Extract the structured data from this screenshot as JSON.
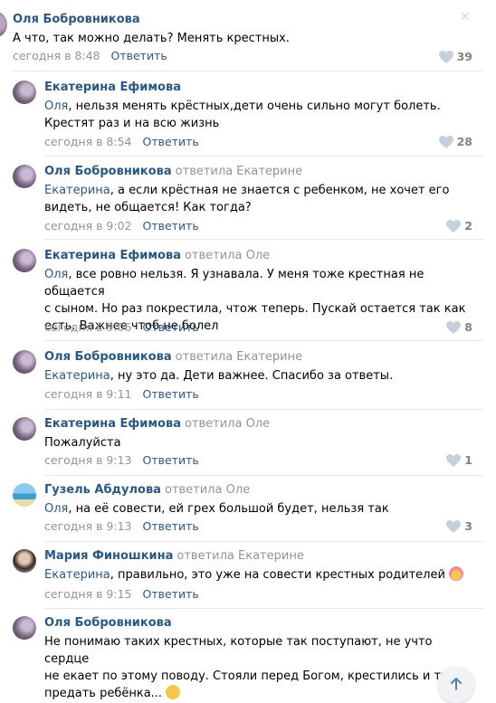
{
  "root": {
    "author": "Оля Бобровникова",
    "text": "А что, так можно делать? Менять крестных.",
    "time": "сегодня в 8:48",
    "reply_label": "Ответить",
    "likes": "39"
  },
  "comments": [
    {
      "author": "Екатерина Ефимова",
      "answered": "",
      "mention": "Оля",
      "text_lines": [
        ", нельзя менять крёстных,дети очень сильно могут болеть.",
        "Крестят раз и на всю жизнь"
      ],
      "time": "сегодня в 8:54",
      "reply_label": "Ответить",
      "likes": "28"
    },
    {
      "author": "Оля Бобровникова",
      "answered": "ответила Екатерине",
      "mention": "Екатерина",
      "text_lines": [
        ", а если крёстная не знается с ребенком, не хочет его",
        "видеть, не общается! Как тогда?"
      ],
      "time": "сегодня в 9:02",
      "reply_label": "Ответить",
      "likes": "2"
    },
    {
      "author": "Екатерина Ефимова",
      "answered": "ответила Оле",
      "mention": "Оля",
      "text_lines": [
        ", все ровно нельзя. Я узнавала. У меня тоже крестная не общается",
        "с сыном. Но раз покрестила, чтож теперь. Пускай остается так как",
        "есть. Важнее чтоб не болел"
      ],
      "time": "сегодня в 9:06",
      "reply_label": "Ответить",
      "likes": "8"
    },
    {
      "author": "Оля Бобровникова",
      "answered": "ответила Екатерине",
      "mention": "Екатерина",
      "text_lines": [
        ", ну это да. Дети важнее. Спасибо за ответы."
      ],
      "time": "сегодня в 9:11",
      "reply_label": "Ответить",
      "likes": ""
    },
    {
      "author": "Екатерина Ефимова",
      "answered": "ответила Оле",
      "mention": "",
      "text_lines": [
        "Пожалуйста"
      ],
      "time": "сегодня в 9:13",
      "reply_label": "Ответить",
      "likes": "1"
    },
    {
      "author": "Гузель Абдулова",
      "answered": "ответила Оле",
      "mention": "Оля",
      "text_lines": [
        ", на её совести, ей грех большой будет, нельзя так"
      ],
      "time": "сегодня в 9:13",
      "reply_label": "Ответить",
      "likes": "3"
    },
    {
      "author": "Мария Финошкина",
      "answered": "ответила Екатерине",
      "mention": "Екатерина",
      "text_lines": [
        ", правильно, это уже на совести крестных родителей"
      ],
      "time": "сегодня в 9:15",
      "reply_label": "Ответить",
      "likes": ""
    },
    {
      "author": "Оля Бобровникова",
      "answered": "",
      "mention": "",
      "text_lines": [
        "Не понимаю таких крестных, которые так поступают, не учто сердце",
        "не екает по этому поводу. Стояли перед Богом, крестились и так",
        "предать ребёнка..."
      ],
      "time": "",
      "reply_label": "",
      "likes": ""
    }
  ],
  "icons": {
    "like": "heart-icon",
    "close": "close-icon",
    "scroll_up": "arrow-up-icon"
  },
  "colors": {
    "link": "#2a5885",
    "muted": "#939393",
    "separator": "#e7e8ec"
  }
}
